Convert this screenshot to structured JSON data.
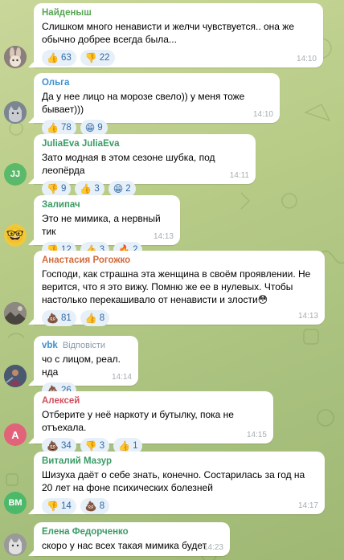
{
  "colors": {
    "wallpaper": "#b9cc88",
    "bubble": "#ffffff",
    "reaction_bg": "#e7f0f8",
    "reaction_text": "#2f6aa6"
  },
  "messages": [
    {
      "author": "Найденыш",
      "author_color": "#58a553",
      "text": "Слишком много ненависти и желчи чувствуется.. она же обычно добрее всегда была...",
      "reactions": [
        {
          "emoji": "👍",
          "count": "63"
        },
        {
          "emoji": "👎",
          "count": "22"
        }
      ],
      "time": "14:10",
      "avatar": {
        "type": "photo",
        "icon": "bunny-icon",
        "bg": "#8a7f7a"
      }
    },
    {
      "author": "Ольга",
      "author_color": "#3c90d0",
      "text": "Да у нее лицо на морозе свело)) у меня тоже бывает)))",
      "reactions": [
        {
          "emoji": "👍",
          "count": "78"
        },
        {
          "emoji": "😁",
          "count": "9"
        }
      ],
      "time": "14:10",
      "avatar": {
        "type": "photo",
        "icon": "cat-icon",
        "bg": "#7d8690"
      }
    },
    {
      "author": "JuliaEva JuliaEva",
      "author_color": "#3a9b65",
      "text": "Зато модная в этом сезоне шубка, под леопёрда",
      "reactions": [
        {
          "emoji": "👎",
          "count": "9"
        },
        {
          "emoji": "👍",
          "count": "3"
        },
        {
          "emoji": "😁",
          "count": "2"
        }
      ],
      "time": "14:11",
      "avatar": {
        "type": "initials",
        "text": "JJ",
        "bg": "#5bb96a"
      }
    },
    {
      "author": "Залипач",
      "author_color": "#3a9b65",
      "text": "Это не мимика, а нервный тик",
      "reactions": [
        {
          "emoji": "👎",
          "count": "12"
        },
        {
          "emoji": "👍",
          "count": "3"
        },
        {
          "emoji": "🔥",
          "count": "2"
        }
      ],
      "time": "14:13",
      "avatar": {
        "type": "emoji",
        "text": "🤓",
        "bg": "#f0c93a"
      }
    },
    {
      "author": "Анастасия Рогожко",
      "author_color": "#d26a3b",
      "text": "Господи, как страшна эта женщина в своём проявлении. Не верится, что я это вижу. Помню же ее в нулевых. Чтобы настолько перекашивало от ненависти и злости😳",
      "reactions": [
        {
          "emoji": "💩",
          "count": "81"
        },
        {
          "emoji": "👍",
          "count": "8"
        }
      ],
      "time": "14:13",
      "avatar": {
        "type": "photo",
        "icon": "landscape-icon",
        "bg": "#6e6a62"
      }
    },
    {
      "author": "vbk",
      "author_color": "#3c90d0",
      "reply_label": "Відповісти",
      "text": "чо с лицом, реал. нда",
      "reactions": [
        {
          "emoji": "💩",
          "count": "26"
        }
      ],
      "time": "14:14",
      "avatar": {
        "type": "photo",
        "icon": "figure-icon",
        "bg": "#4a5870"
      }
    },
    {
      "author": "Алексей",
      "author_color": "#cf4f5c",
      "text": "Отберите у неё наркоту и бутылку, пока не отъехала.",
      "reactions": [
        {
          "emoji": "💩",
          "count": "34"
        },
        {
          "emoji": "👎",
          "count": "3"
        },
        {
          "emoji": "👍",
          "count": "1"
        }
      ],
      "time": "14:15",
      "avatar": {
        "type": "initials",
        "text": "А",
        "bg": "#e2627a"
      }
    },
    {
      "author": "Виталий Мазур",
      "author_color": "#3a9b65",
      "text": "Шизуха даёт о себе знать, конечно. Состарилась за год на 20 лет на фоне психических болезней",
      "reactions": [
        {
          "emoji": "👎",
          "count": "14"
        },
        {
          "emoji": "💩",
          "count": "8"
        }
      ],
      "time": "14:17",
      "avatar": {
        "type": "initials",
        "text": "ВМ",
        "bg": "#4cb86a"
      }
    },
    {
      "author": "Елена Федорченко",
      "author_color": "#3a9b65",
      "text": "скоро у нас всех такая мимика будет",
      "reactions": [],
      "time": "14:23",
      "avatar": {
        "type": "photo",
        "icon": "cat-icon",
        "bg": "#9a9a9a"
      }
    }
  ]
}
